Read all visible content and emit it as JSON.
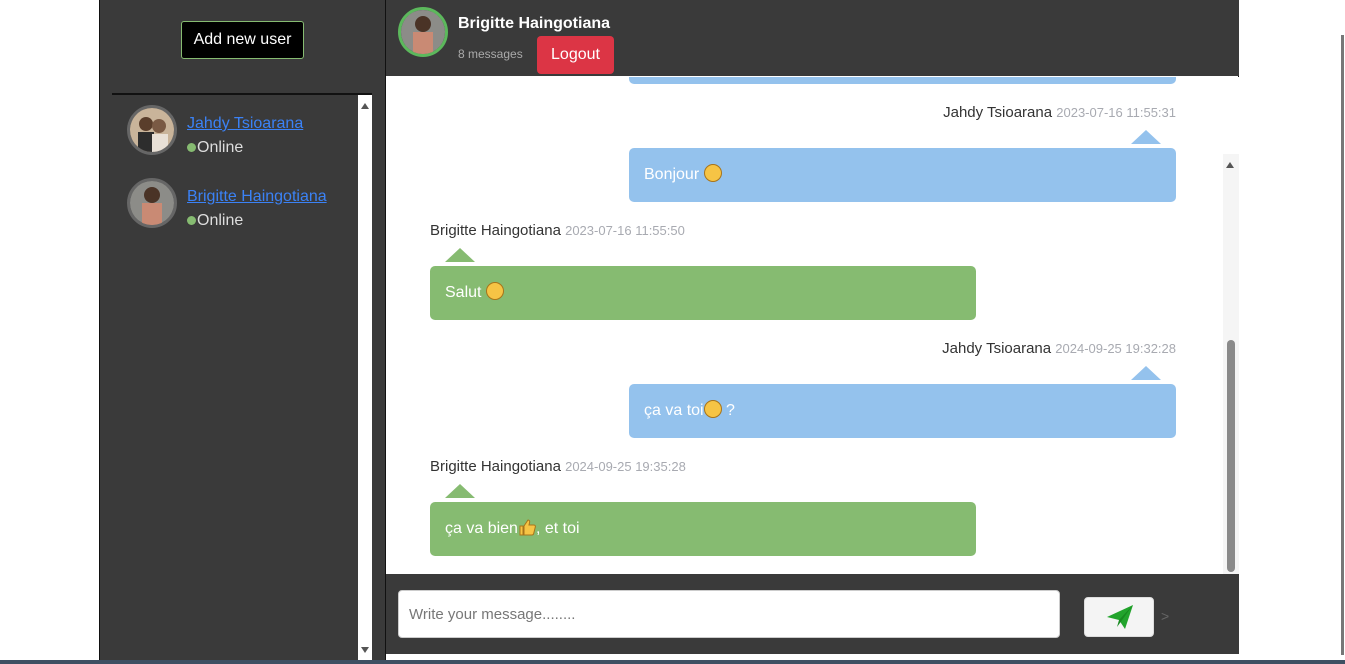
{
  "sidebar": {
    "add_user_label": "Add new user",
    "users": [
      {
        "name": "Jahdy Tsioarana",
        "status": "Online"
      },
      {
        "name": "Brigitte Haingotiana",
        "status": "Online"
      }
    ]
  },
  "header": {
    "name": "Brigitte Haingotiana",
    "count": "8 messages",
    "logout_label": "Logout"
  },
  "messages": [
    {
      "author": "Jahdy Tsioarana",
      "time": "2023-07-16 11:55:31",
      "text": "Bonjour"
    },
    {
      "author": "Brigitte Haingotiana",
      "time": "2023-07-16 11:55:50",
      "text": "Salut"
    },
    {
      "author": "Jahdy Tsioarana",
      "time": "2024-09-25 19:32:28",
      "text": "ça va toi",
      "text2": " ?"
    },
    {
      "author": "Brigitte Haingotiana",
      "time": "2024-09-25 19:35:28",
      "text": "ça va bien",
      "text2": ", et toi"
    }
  ],
  "composer": {
    "placeholder": "Write your message........",
    "send_caret": ">"
  },
  "colors": {
    "outgoing_bubble": "#94c2ed",
    "incoming_bubble": "#86bb71",
    "logout": "#dc3545"
  }
}
